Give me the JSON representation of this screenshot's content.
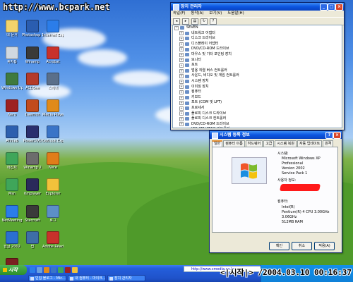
{
  "watermark": "http://www.bcpark.net",
  "desktop_icons": [
    {
      "label": "내 문서",
      "color": "#f2d36b"
    },
    {
      "label": "Photoshop 7.0",
      "color": "#2a5db0"
    },
    {
      "label": "Internet Explorer",
      "color": "#2b7de9"
    },
    {
      "label": "휴지통",
      "color": "#d0d8e0"
    },
    {
      "label": "Winamp",
      "color": "#3a3a3a"
    },
    {
      "label": "Acrobat",
      "color": "#c8312b"
    },
    {
      "label": "Windows Update",
      "color": "#3f7a3f"
    },
    {
      "label": "ACDSee",
      "color": "#b43a2a"
    },
    {
      "label": "스캐너",
      "color": "#5a6f8a"
    },
    {
      "label": "Nero",
      "color": "#9d2121"
    },
    {
      "label": "Daemon",
      "color": "#c24b1d"
    },
    {
      "label": "Media Player",
      "color": "#e08a1a"
    },
    {
      "label": "Ahnlab",
      "color": "#2d5fae"
    },
    {
      "label": "PowerDVD",
      "color": "#2a2f6e"
    },
    {
      "label": "Outlook Express",
      "color": "#3a74c7"
    },
    {
      "label": "메신저",
      "color": "#3fa65a"
    },
    {
      "label": "Winamp 2",
      "color": "#6c6c6c"
    },
    {
      "label": "Nate",
      "color": "#e07d1a"
    },
    {
      "label": "Msn",
      "color": "#3fa65a"
    },
    {
      "label": "Kmplayer",
      "color": "#2a2a5a"
    },
    {
      "label": "Explorer",
      "color": "#f2c23b"
    },
    {
      "label": "NetMeeting",
      "color": "#2b7de9"
    },
    {
      "label": "Starcraft",
      "color": "#3a3a3a"
    },
    {
      "label": "로그",
      "color": "#5c8fc7"
    },
    {
      "label": "한글 2002",
      "color": "#2b6fd0"
    },
    {
      "label": "팝",
      "color": "#3e6ea8"
    },
    {
      "label": "Adobe Reader 6.0",
      "color": "#c8312b"
    },
    {
      "label": "admin",
      "color": "#7a2020"
    }
  ],
  "device_manager": {
    "title": "장치 관리자",
    "menu": [
      "파일(F)",
      "동작(A)",
      "보기(V)",
      "도움말(H)"
    ],
    "root": "SEVEN",
    "items": [
      "네트워크 어댑터",
      "디스크 드라이브",
      "디스플레이 어댑터",
      "DVD/CD-ROM 드라이브",
      "마우스 및 기타 포인팅 장치",
      "모니터",
      "포트",
      "범용 직렬 버스 컨트롤러",
      "사운드, 비디오 및 게임 컨트롤러",
      "시스템 장치",
      "이미징 장치",
      "컴퓨터",
      "키보드",
      "포트 (COM 및 LPT)",
      "프로세서",
      "플로피 디스크 드라이브",
      "플로피 디스크 컨트롤러",
      "DVD/CD-ROM 드라이브",
      "IDE ATA/ATAPI 컨트롤러",
      "PCMCIA 어댑터",
      "SCSI 및 RAID 컨트롤러"
    ]
  },
  "sysprops": {
    "title": "시스템 등록 정보",
    "tabs": [
      "일반",
      "컴퓨터 이름",
      "하드웨어",
      "고급",
      "시스템 복원",
      "자동 업데이트",
      "원격"
    ],
    "system_label": "시스템:",
    "os": [
      "Microsoft Windows XP",
      "Professional",
      "Version 2002",
      "Service Pack 1"
    ],
    "registered_label": "사용자 정보:",
    "computer_label": "컴퓨터:",
    "cpu": [
      "Intel(R)",
      "Pentium(R) 4 CPU 3.00GHz",
      "3.06GHz",
      "512MB RAM"
    ],
    "buttons": [
      "확인",
      "취소",
      "적용(A)"
    ]
  },
  "taskbar": {
    "start": "시작",
    "address": "http://www.cmedia.co.kr",
    "clock": "<|시작|> /2004.03.10 00:16:37",
    "tasks": [
      "빈집 블로그 - Mic...",
      "내 컴퓨터 - 마이크...",
      "장치 관리자"
    ]
  }
}
